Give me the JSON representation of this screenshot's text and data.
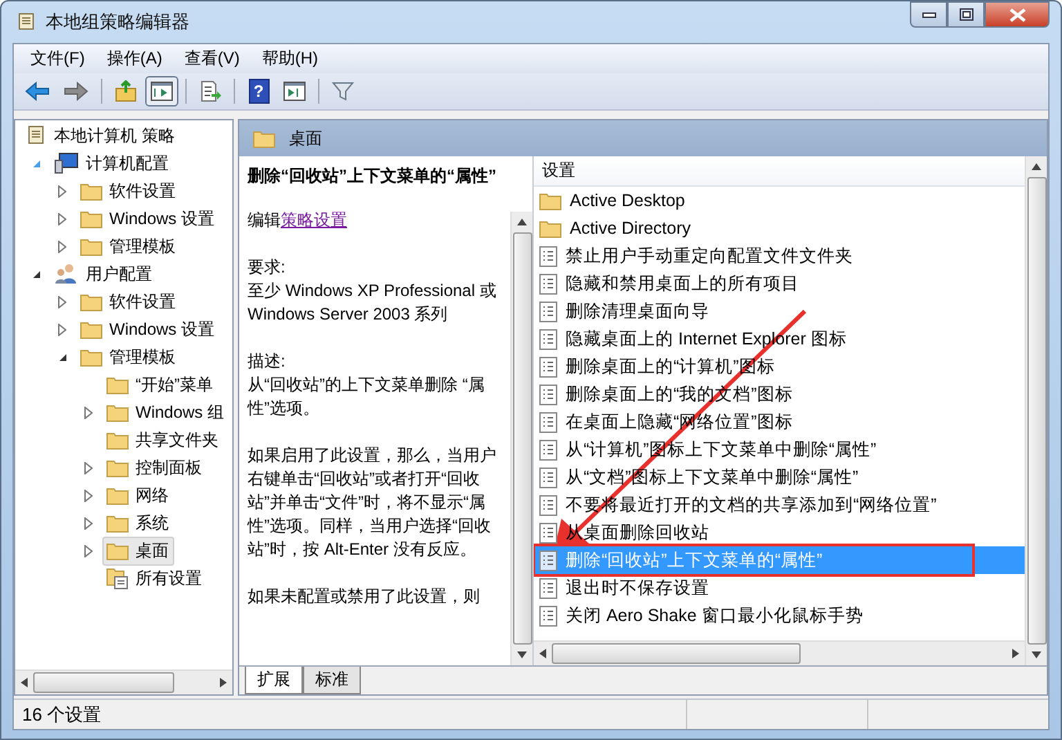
{
  "window": {
    "title": "本地组策略编辑器"
  },
  "menu": [
    "文件(F)",
    "操作(A)",
    "查看(V)",
    "帮助(H)"
  ],
  "toolbar": [
    {
      "kind": "back",
      "disabled": false,
      "pressed": false
    },
    {
      "kind": "forward",
      "disabled": true,
      "pressed": false
    },
    {
      "kind": "sep"
    },
    {
      "kind": "up",
      "disabled": false,
      "pressed": false
    },
    {
      "kind": "tree",
      "disabled": false,
      "pressed": true
    },
    {
      "kind": "sep"
    },
    {
      "kind": "export",
      "disabled": false,
      "pressed": false
    },
    {
      "kind": "sep"
    },
    {
      "kind": "help",
      "glyph": "?",
      "disabled": false,
      "pressed": false
    },
    {
      "kind": "action",
      "disabled": false,
      "pressed": false
    },
    {
      "kind": "sep"
    },
    {
      "kind": "filter",
      "disabled": false,
      "pressed": false
    }
  ],
  "tree": [
    {
      "label": "本地计算机 策略",
      "kind": "policy",
      "expandable": false,
      "selected": false,
      "children": [
        {
          "label": "计算机配置",
          "kind": "computer",
          "expandable": true,
          "expanded": true,
          "selected": false,
          "children": [
            {
              "label": "软件设置",
              "kind": "folder",
              "expandable": true,
              "expanded": false,
              "selected": false
            },
            {
              "label": "Windows 设置",
              "kind": "folder",
              "expandable": true,
              "expanded": false,
              "selected": false
            },
            {
              "label": "管理模板",
              "kind": "folder",
              "expandable": true,
              "expanded": false,
              "selected": false
            }
          ]
        },
        {
          "label": "用户配置",
          "kind": "user",
          "expandable": true,
          "expanded": true,
          "selected": false,
          "children": [
            {
              "label": "软件设置",
              "kind": "folder",
              "expandable": true,
              "expanded": false,
              "selected": false
            },
            {
              "label": "Windows 设置",
              "kind": "folder",
              "expandable": true,
              "expanded": false,
              "selected": false
            },
            {
              "label": "管理模板",
              "kind": "folder",
              "expandable": true,
              "expanded": true,
              "selected": false,
              "children": [
                {
                  "label": "“开始”菜单",
                  "kind": "folder",
                  "expandable": false,
                  "selected": false
                },
                {
                  "label": "Windows 组",
                  "kind": "folder",
                  "expandable": true,
                  "expanded": false,
                  "selected": false
                },
                {
                  "label": "共享文件夹",
                  "kind": "folder",
                  "expandable": false,
                  "selected": false
                },
                {
                  "label": "控制面板",
                  "kind": "folder",
                  "expandable": true,
                  "expanded": false,
                  "selected": false
                },
                {
                  "label": "网络",
                  "kind": "folder",
                  "expandable": true,
                  "expanded": false,
                  "selected": false
                },
                {
                  "label": "系统",
                  "kind": "folder",
                  "expandable": true,
                  "expanded": false,
                  "selected": false
                },
                {
                  "label": "桌面",
                  "kind": "folder",
                  "expandable": true,
                  "expanded": false,
                  "selected": true
                },
                {
                  "label": "所有设置",
                  "kind": "all",
                  "expandable": false,
                  "selected": false
                }
              ]
            }
          ]
        }
      ]
    }
  ],
  "header": {
    "title": "桌面"
  },
  "description": {
    "title": "删除“回收站”上下文菜单的“属性”",
    "edit_prefix": "编辑",
    "edit_link": "策略设置",
    "requirements_label": "要求:",
    "requirements": "至少 Windows XP Professional 或 Windows Server 2003 系列",
    "description_label": "描述:",
    "description": "从“回收站”的上下文菜单删除 “属性”选项。",
    "paragraphs": [
      "如果启用了此设置，那么，当用户右键单击“回收站”或者打开“回收站”并单击“文件”时，将不显示“属性”选项。同样，当用户选择“回收站”时，按 Alt-Enter 没有反应。",
      "如果未配置或禁用了此设置，则"
    ]
  },
  "list": {
    "column": "设置",
    "items": [
      {
        "label": "Active Desktop",
        "kind": "folder",
        "selected": false,
        "annotated": false
      },
      {
        "label": "Active Directory",
        "kind": "folder",
        "selected": false,
        "annotated": false
      },
      {
        "label": "禁止用户手动重定向配置文件文件夹",
        "kind": "setting",
        "selected": false,
        "annotated": false
      },
      {
        "label": "隐藏和禁用桌面上的所有项目",
        "kind": "setting",
        "selected": false,
        "annotated": false
      },
      {
        "label": "删除清理桌面向导",
        "kind": "setting",
        "selected": false,
        "annotated": false
      },
      {
        "label": "隐藏桌面上的 Internet Explorer 图标",
        "kind": "setting",
        "selected": false,
        "annotated": false
      },
      {
        "label": "删除桌面上的“计算机”图标",
        "kind": "setting",
        "selected": false,
        "annotated": false
      },
      {
        "label": "删除桌面上的“我的文档”图标",
        "kind": "setting",
        "selected": false,
        "annotated": false
      },
      {
        "label": "在桌面上隐藏“网络位置”图标",
        "kind": "setting",
        "selected": false,
        "annotated": false
      },
      {
        "label": "从“计算机”图标上下文菜单中删除“属性”",
        "kind": "setting",
        "selected": false,
        "annotated": false
      },
      {
        "label": "从“文档”图标上下文菜单中删除“属性”",
        "kind": "setting",
        "selected": false,
        "annotated": false
      },
      {
        "label": "不要将最近打开的文档的共享添加到“网络位置”",
        "kind": "setting",
        "selected": false,
        "annotated": false
      },
      {
        "label": "从桌面删除回收站",
        "kind": "setting",
        "selected": false,
        "annotated": false
      },
      {
        "label": "删除“回收站”上下文菜单的“属性”",
        "kind": "setting",
        "selected": true,
        "annotated": true
      },
      {
        "label": "退出时不保存设置",
        "kind": "setting",
        "selected": false,
        "annotated": false
      },
      {
        "label": "关闭 Aero Shake 窗口最小化鼠标手势",
        "kind": "setting",
        "selected": false,
        "annotated": false
      }
    ]
  },
  "tabs": [
    {
      "label": "扩展",
      "selected": true
    },
    {
      "label": "标准",
      "selected": false
    }
  ],
  "status_bar": "16 个设置"
}
